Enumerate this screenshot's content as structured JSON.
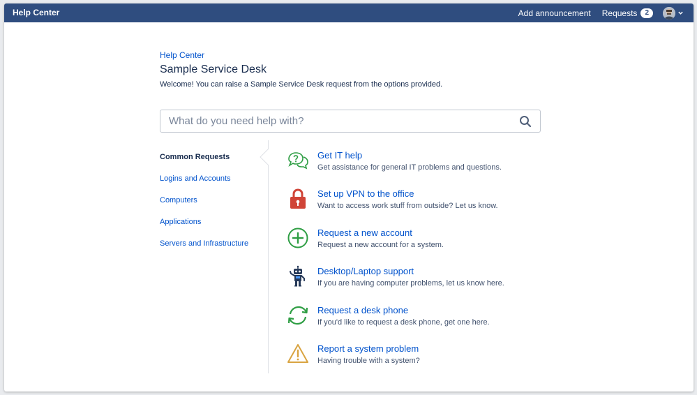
{
  "topbar": {
    "brand": "Help Center",
    "add_announcement": "Add announcement",
    "requests_label": "Requests",
    "requests_count": "2"
  },
  "breadcrumb": "Help Center",
  "title": "Sample Service Desk",
  "welcome": "Welcome! You can raise a Sample Service Desk request from the options provided.",
  "search": {
    "placeholder": "What do you need help with?"
  },
  "sidebar": {
    "items": [
      {
        "label": "Common Requests",
        "active": true
      },
      {
        "label": "Logins and Accounts",
        "active": false
      },
      {
        "label": "Computers",
        "active": false
      },
      {
        "label": "Applications",
        "active": false
      },
      {
        "label": "Servers and Infrastructure",
        "active": false
      }
    ]
  },
  "requests": [
    {
      "title": "Get IT help",
      "description": "Get assistance for general IT problems and questions.",
      "icon": "speech-bubbles-question-icon"
    },
    {
      "title": "Set up VPN to the office",
      "description": "Want to access work stuff from outside? Let us know.",
      "icon": "padlock-icon"
    },
    {
      "title": "Request a new account",
      "description": "Request a new account for a system.",
      "icon": "plus-circle-icon"
    },
    {
      "title": "Desktop/Laptop support",
      "description": "If you are having computer problems, let us know here.",
      "icon": "robot-icon"
    },
    {
      "title": "Request a desk phone",
      "description": "If you'd like to request a desk phone, get one here.",
      "icon": "refresh-arrows-icon"
    },
    {
      "title": "Report a system problem",
      "description": "Having trouble with a system?",
      "icon": "warning-triangle-icon"
    }
  ],
  "colors": {
    "topbar": "#2f4d7f",
    "link": "#0052cc",
    "text": "#172b4d",
    "green": "#2f9e44",
    "red": "#d04437",
    "amber": "#d9a441",
    "navy": "#253858"
  }
}
